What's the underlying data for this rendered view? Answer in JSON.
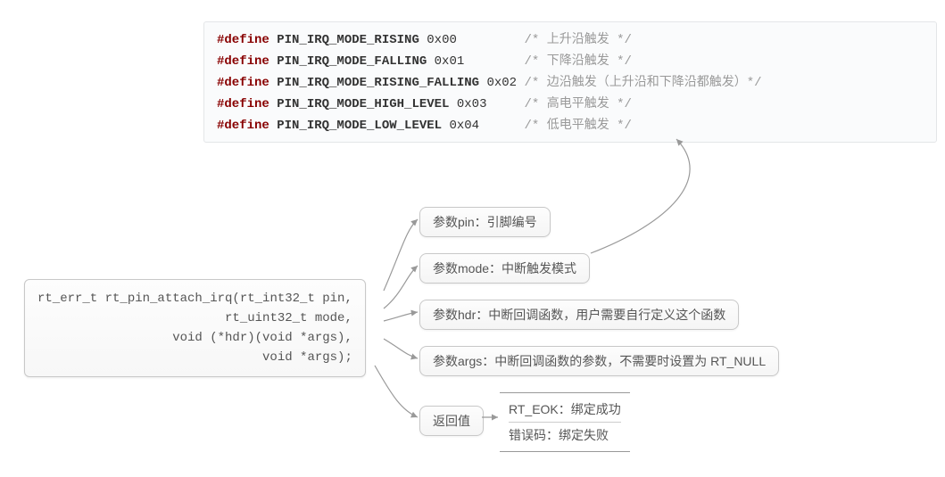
{
  "code": {
    "lines": [
      {
        "kw": "#define",
        "macro": "PIN_IRQ_MODE_RISING",
        "val": "0x00",
        "pad": "        ",
        "cmt": "/* 上升沿触发 */"
      },
      {
        "kw": "#define",
        "macro": "PIN_IRQ_MODE_FALLING",
        "val": "0x01",
        "pad": "       ",
        "cmt": "/* 下降沿触发 */"
      },
      {
        "kw": "#define",
        "macro": "PIN_IRQ_MODE_RISING_FALLING",
        "val": "0x02",
        "pad": "",
        "cmt": "/* 边沿触发（上升沿和下降沿都触发）*/"
      },
      {
        "kw": "#define",
        "macro": "PIN_IRQ_MODE_HIGH_LEVEL",
        "val": "0x03",
        "pad": "    ",
        "cmt": "/* 高电平触发 */"
      },
      {
        "kw": "#define",
        "macro": "PIN_IRQ_MODE_LOW_LEVEL",
        "val": "0x04",
        "pad": "     ",
        "cmt": "/* 低电平触发 */"
      }
    ]
  },
  "func": {
    "l1": "rt_err_t rt_pin_attach_irq(rt_int32_t pin,",
    "l2": "rt_uint32_t mode,",
    "l3": "void (*hdr)(void *args),",
    "l4": "void *args);"
  },
  "bubbles": {
    "pin": "参数pin：引脚编号",
    "mode": "参数mode：中断触发模式",
    "hdr": "参数hdr：中断回调函数，用户需要自行定义这个函数",
    "args": "参数args：中断回调函数的参数，不需要时设置为 RT_NULL"
  },
  "ret": {
    "label": "返回值",
    "ok": "RT_EOK：绑定成功",
    "err": "错误码：绑定失败"
  }
}
